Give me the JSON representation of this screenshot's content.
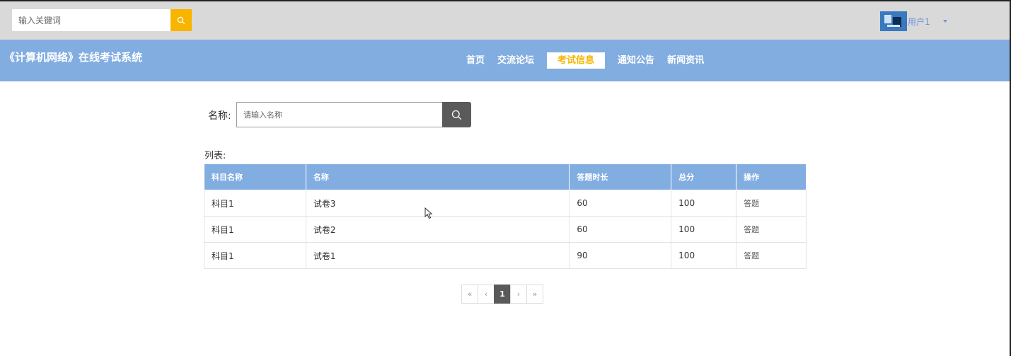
{
  "topbar": {
    "search_placeholder": "输入关键词",
    "user_name": "用户1"
  },
  "header": {
    "site_title": "《计算机网络》在线考试系统",
    "nav": [
      {
        "label": "首页",
        "active": false
      },
      {
        "label": "交流论坛",
        "active": false
      },
      {
        "label": "考试信息",
        "active": true
      },
      {
        "label": "通知公告",
        "active": false
      },
      {
        "label": "新闻资讯",
        "active": false
      }
    ]
  },
  "search": {
    "label": "名称:",
    "placeholder": "请输入名称"
  },
  "list": {
    "label": "列表:",
    "columns": [
      "科目名称",
      "名称",
      "答题时长",
      "总分",
      "操作"
    ],
    "rows": [
      {
        "subject": "科目1",
        "name": "试卷3",
        "duration": "60",
        "score": "100",
        "action": "答题"
      },
      {
        "subject": "科目1",
        "name": "试卷2",
        "duration": "60",
        "score": "100",
        "action": "答题"
      },
      {
        "subject": "科目1",
        "name": "试卷1",
        "duration": "90",
        "score": "100",
        "action": "答题"
      }
    ]
  },
  "pagination": {
    "first": "«",
    "prev": "‹",
    "current": "1",
    "next": "›",
    "last": "»"
  },
  "colors": {
    "accent": "#f7b500",
    "header_bg": "#82ade1",
    "topbar_bg": "#d9d9d9",
    "dark_button": "#5a5a5a"
  },
  "icons": {
    "top_search": "search-icon",
    "name_search": "search-icon",
    "user_menu": "caret-down-icon"
  }
}
